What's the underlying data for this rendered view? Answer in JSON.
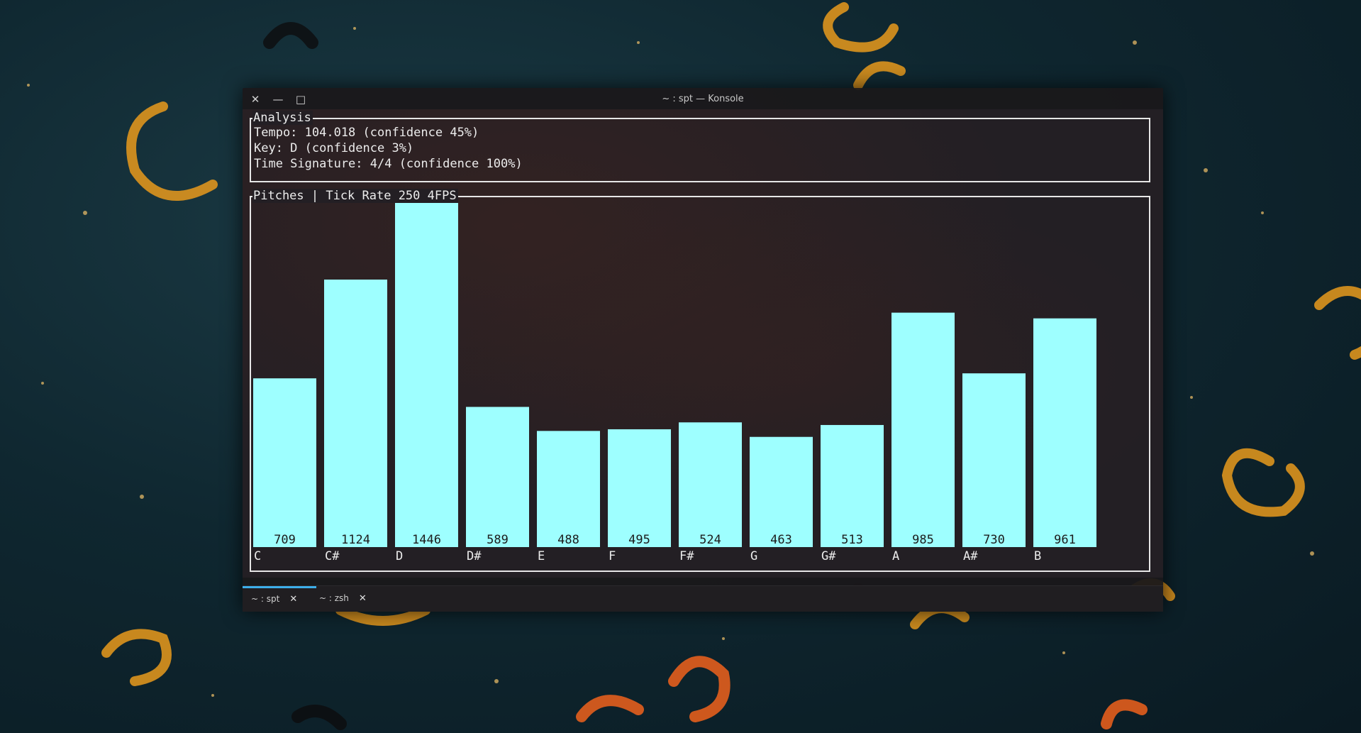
{
  "window": {
    "title": "~ : spt — Konsole",
    "close_icon": "close-icon",
    "minimize_icon": "minimize-icon",
    "maximize_icon": "maximize-icon"
  },
  "analysis": {
    "box_title": "Analysis",
    "tempo": "Tempo: 104.018 (confidence 45%)",
    "key": "Key: D (confidence 3%)",
    "time_signature": "Time Signature: 4/4 (confidence 100%)"
  },
  "pitches": {
    "box_title": "Pitches | Tick Rate 250 4FPS"
  },
  "chart_data": {
    "type": "bar",
    "categories": [
      "C",
      "C#",
      "D",
      "D#",
      "E",
      "F",
      "F#",
      "G",
      "G#",
      "A",
      "A#",
      "B"
    ],
    "values": [
      709,
      1124,
      1446,
      589,
      488,
      495,
      524,
      463,
      513,
      985,
      730,
      961
    ],
    "title": "",
    "xlabel": "",
    "ylabel": "",
    "ylim": [
      0,
      1446
    ],
    "bar_color": "#9effff",
    "label_color": "#1c1c1c"
  },
  "tabs": [
    {
      "label": "~ : spt",
      "active": true
    },
    {
      "label": "~ : zsh",
      "active": false
    }
  ],
  "colors": {
    "accent": "#3daee9",
    "border": "#e6e6e6"
  }
}
